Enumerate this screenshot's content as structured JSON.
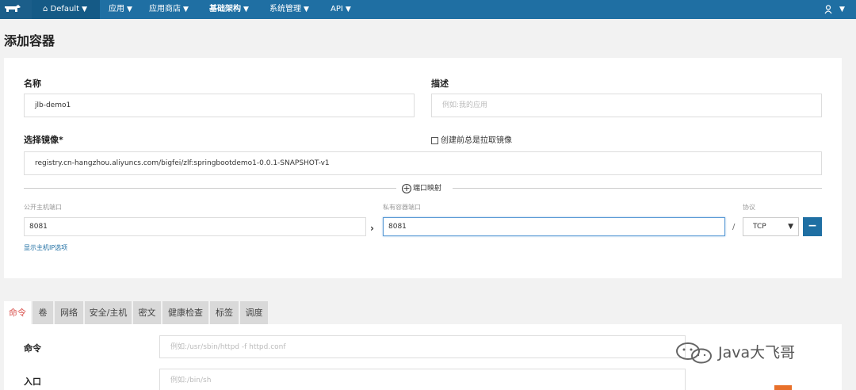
{
  "nav": {
    "env_label": "Default",
    "items": [
      "应用",
      "应用商店",
      "基础架构",
      "系统管理",
      "API"
    ],
    "active_index": 2
  },
  "page": {
    "title": "添加容器"
  },
  "form": {
    "name_label": "名称",
    "name_value": "jlb-demo1",
    "desc_label": "描述",
    "desc_placeholder": "例如:我的应用",
    "image_label": "选择镜像*",
    "image_value": "registry.cn-hangzhou.aliyuncs.com/bigfei/zlf:springbootdemo1-0.0.1-SNAPSHOT-v1",
    "pull_checkbox_label": "创建前总是拉取镜像",
    "pull_checked": false,
    "port_map_label": "端口映射",
    "public_port_label": "公开主机端口",
    "public_port_value": "8081",
    "private_port_label": "私有容器端口",
    "private_port_value": "8081",
    "protocol_label": "协议",
    "protocol_value": "TCP",
    "show_ip_link": "显示主机IP选项"
  },
  "tabs": [
    "命令",
    "卷",
    "网络",
    "安全/主机",
    "密文",
    "健康检查",
    "标签",
    "调度"
  ],
  "active_tab": 0,
  "command_panel": {
    "cmd_label": "命令",
    "cmd_placeholder": "例如:/usr/sbin/httpd -f httpd.conf",
    "entry_label": "入口",
    "entry_placeholder": "例如:/bin/sh"
  },
  "watermark": {
    "text": "Java大飞哥"
  },
  "colors": {
    "nav": "#1f6fa3",
    "active_tab_text": "#d9534f"
  }
}
